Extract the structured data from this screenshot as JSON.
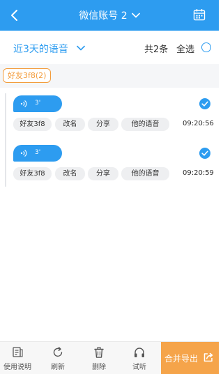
{
  "header": {
    "title": "微信账号 2",
    "bg_color": "#2d9cf0",
    "icons": [
      "back-icon",
      "chevron-down-icon",
      "calendar-icon"
    ]
  },
  "filter": {
    "range_label": "近3天的语音",
    "count_label": "共2条",
    "select_all_label": "全选"
  },
  "group": {
    "tag_label": "好友3f8(2)",
    "tag_color": "#f39c3c"
  },
  "messages": [
    {
      "duration": "3'",
      "actions": [
        "好友3f8",
        "改名",
        "分享",
        "他的语音"
      ],
      "time": "09:20:56",
      "checked": true
    },
    {
      "duration": "3'",
      "actions": [
        "好友3f8",
        "改名",
        "分享",
        "他的语音"
      ],
      "time": "09:20:59",
      "checked": true
    }
  ],
  "bottom_bar": {
    "tabs": [
      {
        "label": "使用说明",
        "icon": "document-icon"
      },
      {
        "label": "刷新",
        "icon": "refresh-icon"
      },
      {
        "label": "删除",
        "icon": "trash-icon"
      },
      {
        "label": "试听",
        "icon": "headphones-icon"
      }
    ],
    "export_label": "合并导出",
    "export_icon": "share-icon",
    "export_color": "#f5a44a"
  }
}
